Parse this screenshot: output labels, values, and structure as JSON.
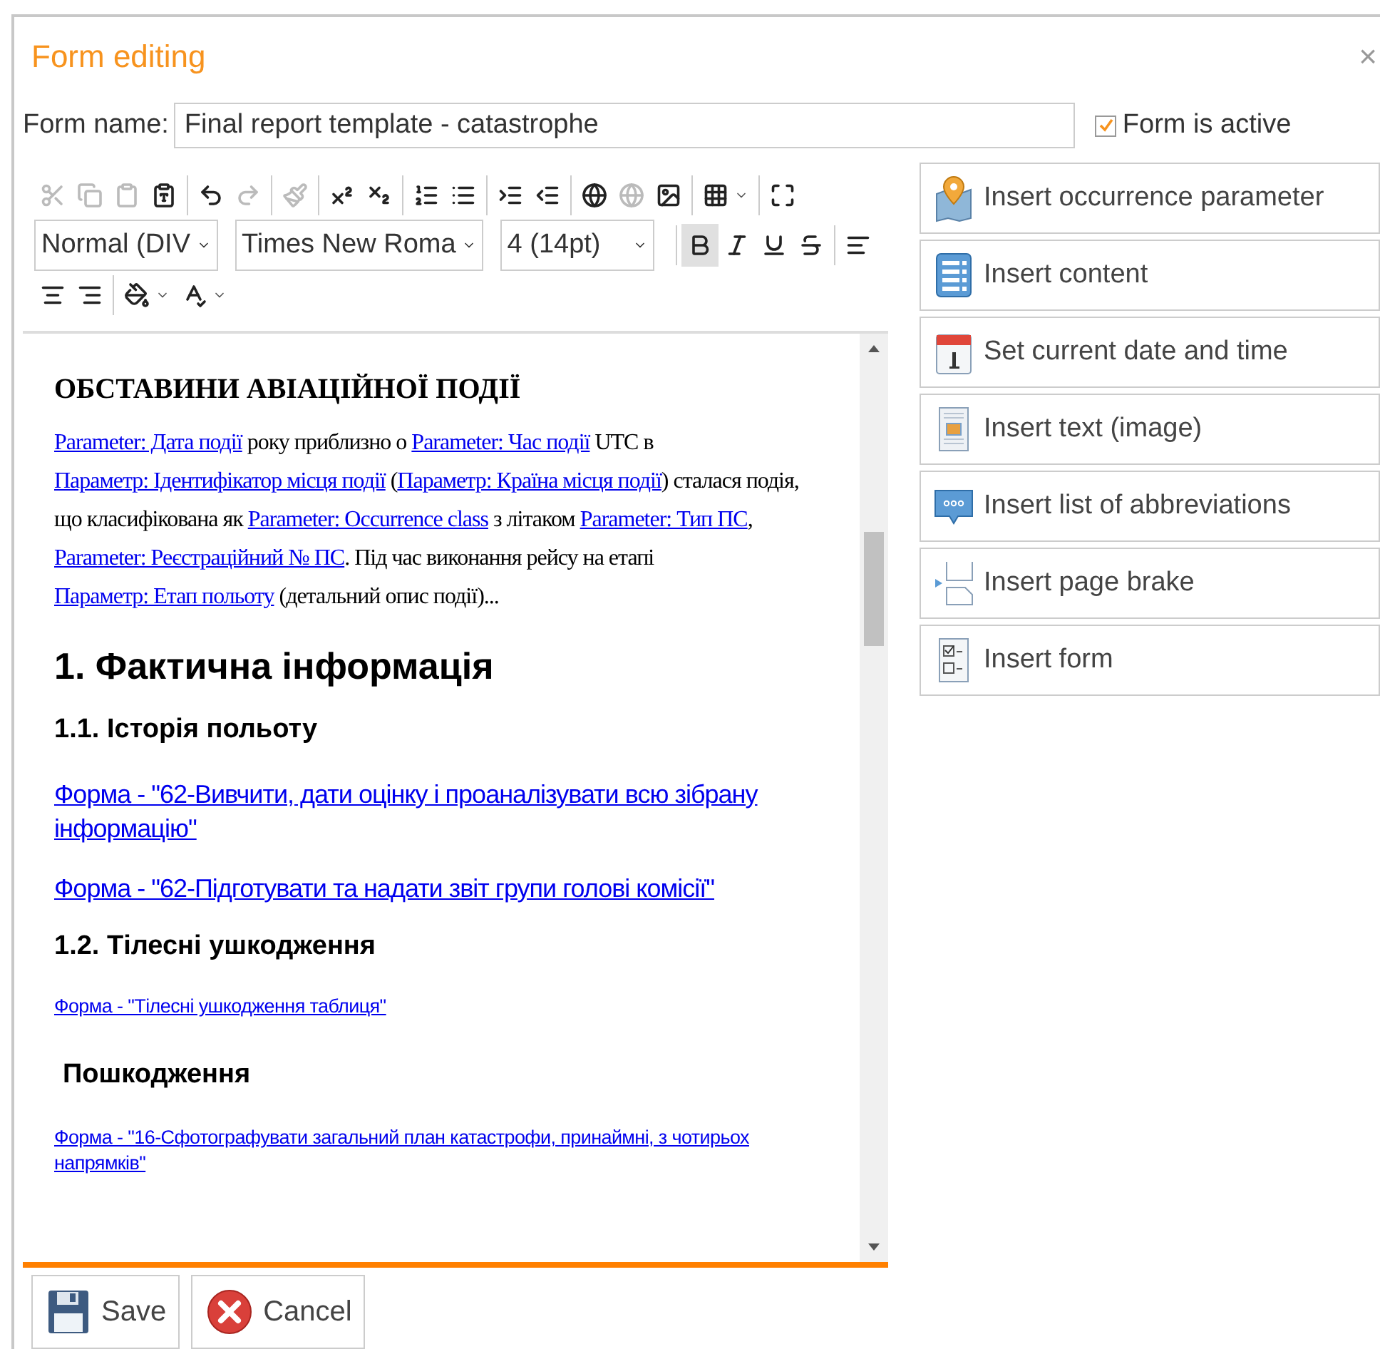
{
  "dialog": {
    "title": "Form editing",
    "close": "×"
  },
  "form_name": {
    "label": "Form name:",
    "value": "Final report template - catastrophe"
  },
  "active": {
    "label": "Form is active",
    "checked": true
  },
  "toolbar_rows": [
    [
      {
        "kind": "cut",
        "disabled": true
      },
      {
        "kind": "copy",
        "disabled": true
      },
      {
        "kind": "paste",
        "disabled": true
      },
      {
        "kind": "paste-word",
        "disabled": false
      },
      {
        "kind": "separator"
      },
      {
        "kind": "undo",
        "disabled": false
      },
      {
        "kind": "redo",
        "disabled": true
      },
      {
        "kind": "separator"
      },
      {
        "kind": "format-painter",
        "disabled": true
      },
      {
        "kind": "separator"
      },
      {
        "kind": "superscript",
        "disabled": false
      },
      {
        "kind": "subscript",
        "disabled": false
      },
      {
        "kind": "separator"
      },
      {
        "kind": "ordered-list",
        "disabled": false
      },
      {
        "kind": "bullet-list",
        "disabled": false
      },
      {
        "kind": "separator"
      },
      {
        "kind": "indent",
        "disabled": false
      },
      {
        "kind": "outdent",
        "disabled": false
      },
      {
        "kind": "separator"
      },
      {
        "kind": "link",
        "disabled": false
      },
      {
        "kind": "unlink",
        "disabled": true
      },
      {
        "kind": "image",
        "disabled": false
      },
      {
        "kind": "separator"
      },
      {
        "kind": "table",
        "disabled": false
      },
      {
        "kind": "caret",
        "disabled": false
      },
      {
        "kind": "separator"
      },
      {
        "kind": "maximize",
        "disabled": false
      }
    ],
    [
      {
        "kind": "dropdown",
        "value": "Normal (DIV"
      },
      {
        "kind": "dropdown",
        "value": "Times New Roma"
      },
      {
        "kind": "dropdown",
        "value": "4 (14pt)"
      },
      {
        "kind": "separator"
      },
      {
        "kind": "bold",
        "disabled": false,
        "on": true
      },
      {
        "kind": "italic",
        "disabled": false,
        "on": false
      },
      {
        "kind": "underline",
        "disabled": false,
        "on": false
      },
      {
        "kind": "strike",
        "disabled": false,
        "on": false
      },
      {
        "kind": "separator"
      },
      {
        "kind": "align-left",
        "disabled": false
      }
    ],
    [
      {
        "kind": "align-center",
        "disabled": false
      },
      {
        "kind": "align-right",
        "disabled": false
      },
      {
        "kind": "separator"
      },
      {
        "kind": "fill-color",
        "disabled": false
      },
      {
        "kind": "caret",
        "disabled": false
      },
      {
        "kind": "spellcheck",
        "disabled": false
      },
      {
        "kind": "caret",
        "disabled": false
      }
    ]
  ],
  "document": [
    {
      "kind": "title",
      "text": "ОБСТАВИНИ АВІАЦІЙНОЇ ПОДІЇ"
    },
    {
      "kind": "paragraph",
      "segments": [
        {
          "link": true,
          "text": "Parameter: Дата події"
        },
        {
          "link": false,
          "text": " року приблизно о "
        },
        {
          "link": true,
          "text": "Parameter: Час події"
        },
        {
          "link": false,
          "text": " UTC в  "
        },
        {
          "link": true,
          "text": "Параметр: Ідентифікатор місця події"
        },
        {
          "link": false,
          "text": " ("
        },
        {
          "link": true,
          "text": "Параметр: Країна місця події"
        },
        {
          "link": false,
          "text": ") сталася подія, що класифікована як "
        },
        {
          "link": true,
          "text": "Parameter: Occurrence class"
        },
        {
          "link": false,
          "text": " з літаком "
        },
        {
          "link": true,
          "text": "Parameter: Тип ПС"
        },
        {
          "link": false,
          "text": ", "
        },
        {
          "link": true,
          "text": "Parameter: Реєстраційний № ПС"
        },
        {
          "link": false,
          "text": ". Під час виконання рейсу на етапі "
        },
        {
          "link": true,
          "text": "Параметр: Етап польоту"
        },
        {
          "link": false,
          "text": " (детальний опис події)..."
        }
      ]
    },
    {
      "kind": "h1",
      "text": "1. Фактична інформація"
    },
    {
      "kind": "h2",
      "text": "1.1. Історія польоту"
    },
    {
      "kind": "link",
      "text": "Форма - \"62-Вивчити, дати оцінку і проаналізувати всю зібрану інформацію\""
    },
    {
      "kind": "link",
      "text": "Форма - \"62-Підготувати та надати звіт групи голові комісії\""
    },
    {
      "kind": "h2",
      "text": "1.2. Тілесні ушкодження"
    },
    {
      "kind": "small-link",
      "text": "Форма - \"Тілесні ушкодження таблиця\""
    },
    {
      "kind": "h3",
      "text": "Пошкодження"
    },
    {
      "kind": "small-link",
      "text": "Форма - \"16-Сфотографувати загальний план катастрофи, принаймні, з чотирьох напрямків\""
    }
  ],
  "side_actions": [
    {
      "kind": "location",
      "label": "Insert occurrence parameter"
    },
    {
      "kind": "content",
      "label": "Insert content"
    },
    {
      "kind": "calendar",
      "label": "Set current date and time"
    },
    {
      "kind": "text-image",
      "label": "Insert text (image)"
    },
    {
      "kind": "abbreviations",
      "label": "Insert list of abbreviations"
    },
    {
      "kind": "page-break",
      "label": "Insert page brake"
    },
    {
      "kind": "form",
      "label": "Insert form"
    }
  ],
  "buttons": [
    {
      "kind": "save",
      "label": "Save"
    },
    {
      "kind": "cancel",
      "label": "Cancel"
    }
  ]
}
